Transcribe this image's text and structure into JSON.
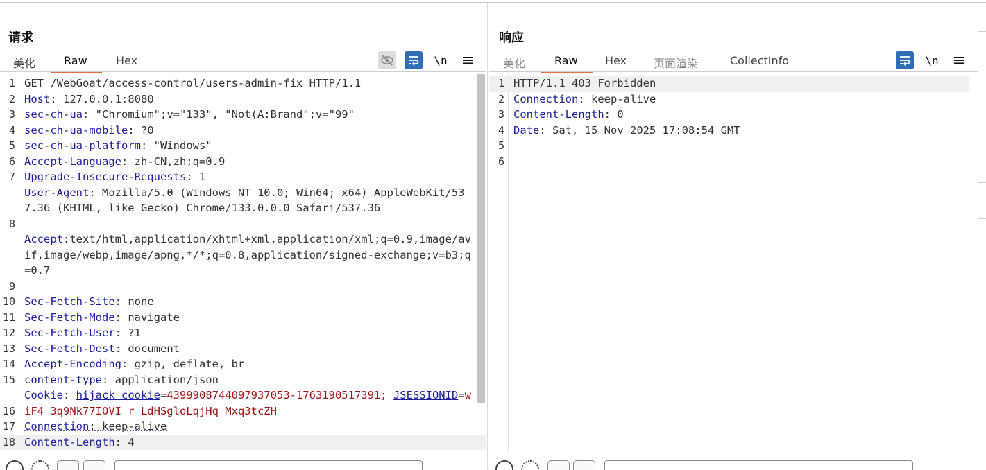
{
  "layout_switch": {
    "active": "side-by-side"
  },
  "request": {
    "title": "请求",
    "tabs": [
      {
        "label": "美化",
        "active": false
      },
      {
        "label": "Raw",
        "active": true
      },
      {
        "label": "Hex",
        "active": false
      }
    ],
    "tools": {
      "newline_label": "\\n"
    },
    "lines": [
      {
        "n": "1",
        "name": "",
        "sep": "",
        "value": "GET /WebGoat/access-control/users-admin-fix HTTP/1.1"
      },
      {
        "n": "2",
        "name": "Host",
        "sep": ": ",
        "value": "127.0.0.1:8080"
      },
      {
        "n": "3",
        "name": "sec-ch-ua",
        "sep": ": ",
        "value": "\"Chromium\";v=\"133\", \"Not(A:Brand\";v=\"99\""
      },
      {
        "n": "4",
        "name": "sec-ch-ua-mobile",
        "sep": ": ",
        "value": "?0"
      },
      {
        "n": "5",
        "name": "sec-ch-ua-platform",
        "sep": ": ",
        "value": "\"Windows\""
      },
      {
        "n": "6",
        "name": "Accept-Language",
        "sep": ": ",
        "value": "zh-CN,zh;q=0.9"
      },
      {
        "n": "7",
        "name": "Upgrade-Insecure-Requests",
        "sep": ": ",
        "value": "1"
      },
      {
        "n": "8",
        "name": "User-Agent",
        "sep": ": ",
        "value": "Mozilla/5.0 (Windows NT 10.0; Win64; x64) AppleWebKit/537.36 (KHTML, like Gecko) Chrome/133.0.0.0 Safari/537.36"
      },
      {
        "n": "9",
        "name": "Accept",
        "sep": ":",
        "value": "text/html,application/xhtml+xml,application/xml;q=0.9,image/avif,image/webp,image/apng,*/*;q=0.8,application/signed-exchange;v=b3;q=0.7"
      },
      {
        "n": "10",
        "name": "Sec-Fetch-Site",
        "sep": ": ",
        "value": "none"
      },
      {
        "n": "11",
        "name": "Sec-Fetch-Mode",
        "sep": ": ",
        "value": "navigate"
      },
      {
        "n": "12",
        "name": "Sec-Fetch-User",
        "sep": ": ",
        "value": "?1"
      },
      {
        "n": "13",
        "name": "Sec-Fetch-Dest",
        "sep": ": ",
        "value": "document"
      },
      {
        "n": "14",
        "name": "Accept-Encoding",
        "sep": ": ",
        "value": "gzip, deflate, br"
      },
      {
        "n": "15",
        "name": "content-type",
        "sep": ": ",
        "value": "application/json"
      },
      {
        "n": "16",
        "name": "Cookie",
        "sep": ": ",
        "value": ""
      },
      {
        "n": "17",
        "name": "Connection",
        "sep": ": ",
        "value": "keep-alive"
      },
      {
        "n": "18",
        "name": "Content-Length",
        "sep": ": ",
        "value": "4"
      }
    ],
    "cookie": {
      "c1_name": "hijack_cookie",
      "c1_value": "4399908744097937053-1763190517391",
      "c2_name": "JSESSIONID",
      "c2_value": "wiF4_3q9Nk77IOVI_r_LdHSgloLqjHq_Mxq3tcZH"
    }
  },
  "response": {
    "title": "响应",
    "tabs": [
      {
        "label": "美化",
        "active": false
      },
      {
        "label": "Raw",
        "active": true
      },
      {
        "label": "Hex",
        "active": false
      },
      {
        "label": "页面渲染",
        "active": false
      },
      {
        "label": "CollectInfo",
        "active": false
      }
    ],
    "tools": {
      "newline_label": "\\n"
    },
    "lines": [
      {
        "n": "1",
        "name": "",
        "sep": "",
        "value": "HTTP/1.1 403 Forbidden"
      },
      {
        "n": "2",
        "name": "Connection",
        "sep": ": ",
        "value": "keep-alive"
      },
      {
        "n": "3",
        "name": "Content-Length",
        "sep": ": ",
        "value": "0"
      },
      {
        "n": "4",
        "name": "Date",
        "sep": ": ",
        "value": "Sat, 15 Nov 2025 17:08:54 GMT"
      },
      {
        "n": "5",
        "name": "",
        "sep": "",
        "value": ""
      },
      {
        "n": "6",
        "name": "",
        "sep": "",
        "value": ""
      }
    ]
  },
  "colors": {
    "accent": "#2f6db5",
    "tab_underline": "#e8703a",
    "header_name": "#1f1f9e",
    "cookie_value": "#a31515"
  }
}
